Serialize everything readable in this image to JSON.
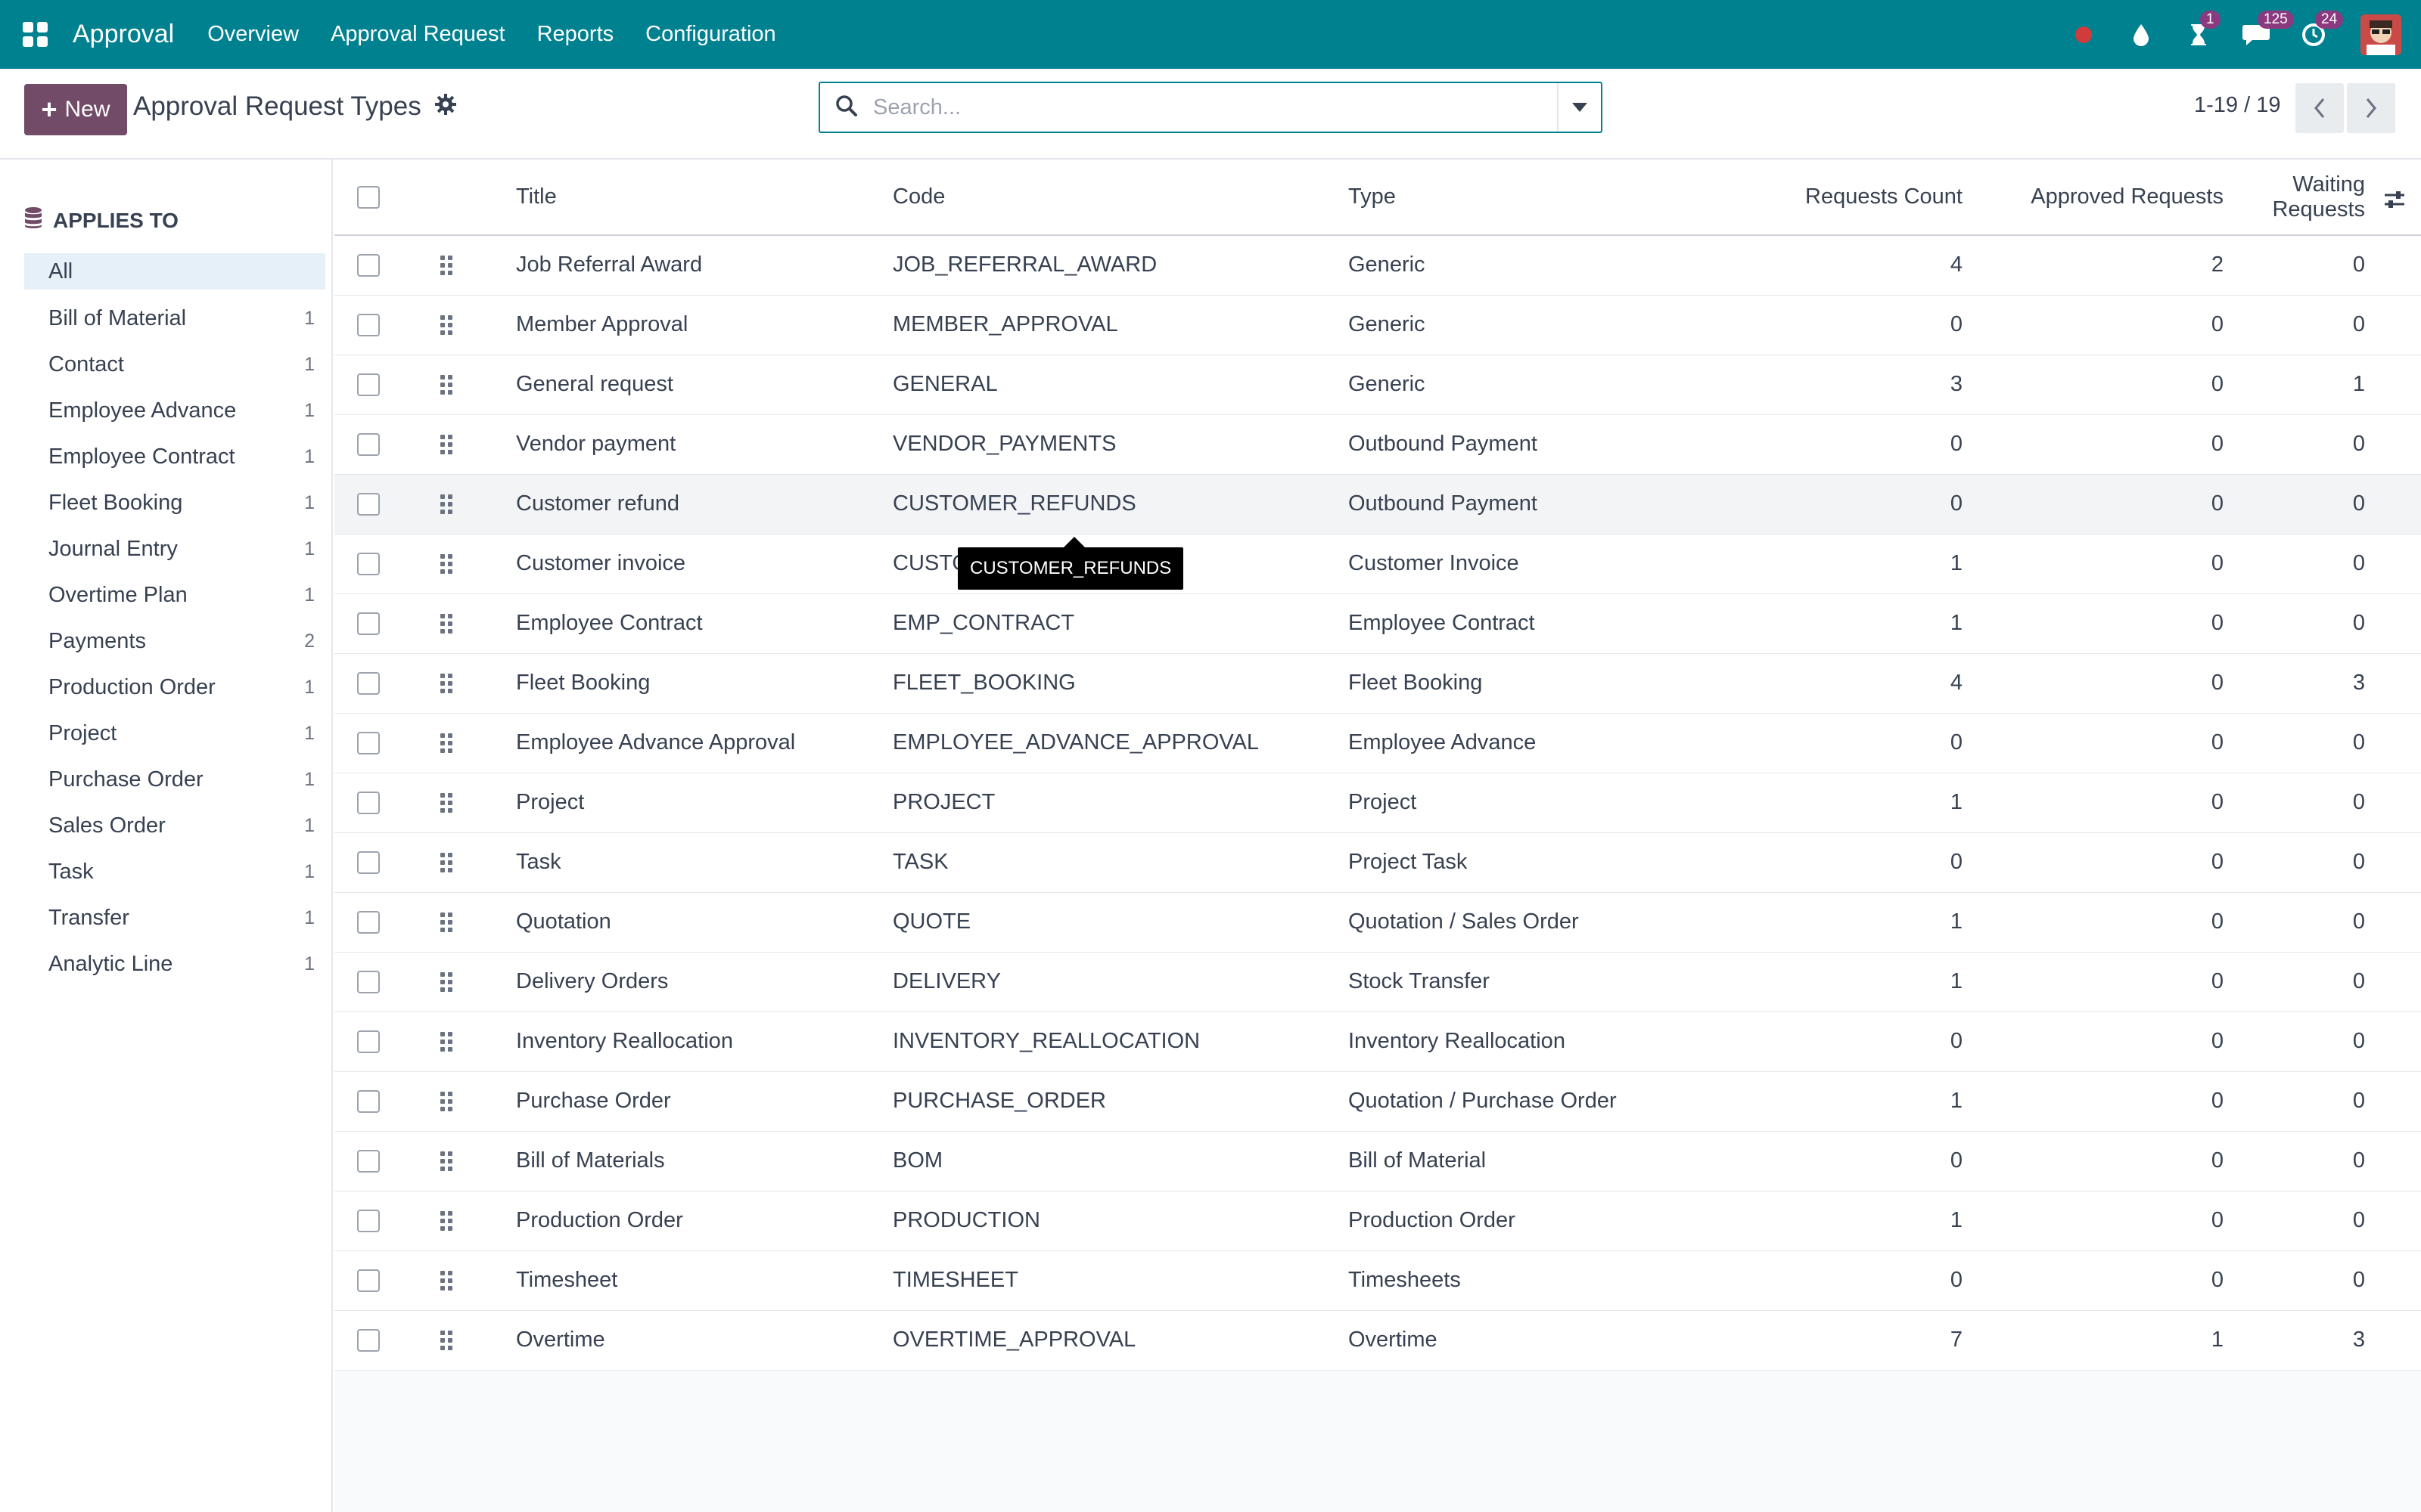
{
  "navbar": {
    "app_name": "Approval",
    "menu": [
      "Overview",
      "Approval Request",
      "Reports",
      "Configuration"
    ],
    "activity_badge": "1",
    "messages_badge": "125",
    "timer_badge": "24"
  },
  "control": {
    "new_label": "New",
    "page_title": "Approval Request Types",
    "search_placeholder": "Search...",
    "pager": "1-19 / 19"
  },
  "sidebar": {
    "heading": "APPLIES TO",
    "items": [
      {
        "label": "All",
        "count": ""
      },
      {
        "label": "Bill of Material",
        "count": "1"
      },
      {
        "label": "Contact",
        "count": "1"
      },
      {
        "label": "Employee Advance",
        "count": "1"
      },
      {
        "label": "Employee Contract",
        "count": "1"
      },
      {
        "label": "Fleet Booking",
        "count": "1"
      },
      {
        "label": "Journal Entry",
        "count": "1"
      },
      {
        "label": "Overtime Plan",
        "count": "1"
      },
      {
        "label": "Payments",
        "count": "2"
      },
      {
        "label": "Production Order",
        "count": "1"
      },
      {
        "label": "Project",
        "count": "1"
      },
      {
        "label": "Purchase Order",
        "count": "1"
      },
      {
        "label": "Sales Order",
        "count": "1"
      },
      {
        "label": "Task",
        "count": "1"
      },
      {
        "label": "Transfer",
        "count": "1"
      },
      {
        "label": "Analytic Line",
        "count": "1"
      }
    ]
  },
  "table": {
    "headers": {
      "title": "Title",
      "code": "Code",
      "type": "Type",
      "requests": "Requests Count",
      "approved": "Approved Requests",
      "waiting": "Waiting Requests"
    },
    "rows": [
      {
        "title": "Job Referral Award",
        "code": "JOB_REFERRAL_AWARD",
        "type": "Generic",
        "requests": "4",
        "approved": "2",
        "waiting": "0"
      },
      {
        "title": "Member Approval",
        "code": "MEMBER_APPROVAL",
        "type": "Generic",
        "requests": "0",
        "approved": "0",
        "waiting": "0"
      },
      {
        "title": "General request",
        "code": "GENERAL",
        "type": "Generic",
        "requests": "3",
        "approved": "0",
        "waiting": "1"
      },
      {
        "title": "Vendor payment",
        "code": "VENDOR_PAYMENTS",
        "type": "Outbound Payment",
        "requests": "0",
        "approved": "0",
        "waiting": "0"
      },
      {
        "title": "Customer refund",
        "code": "CUSTOMER_REFUNDS",
        "type": "Outbound Payment",
        "requests": "0",
        "approved": "0",
        "waiting": "0"
      },
      {
        "title": "Customer invoice",
        "code": "CUSTOMEI",
        "type": "Customer Invoice",
        "requests": "1",
        "approved": "0",
        "waiting": "0"
      },
      {
        "title": "Employee Contract",
        "code": "EMP_CONTRACT",
        "type": "Employee Contract",
        "requests": "1",
        "approved": "0",
        "waiting": "0"
      },
      {
        "title": "Fleet Booking",
        "code": "FLEET_BOOKING",
        "type": "Fleet Booking",
        "requests": "4",
        "approved": "0",
        "waiting": "3"
      },
      {
        "title": "Employee Advance Approval",
        "code": "EMPLOYEE_ADVANCE_APPROVAL",
        "type": "Employee Advance",
        "requests": "0",
        "approved": "0",
        "waiting": "0"
      },
      {
        "title": "Project",
        "code": "PROJECT",
        "type": "Project",
        "requests": "1",
        "approved": "0",
        "waiting": "0"
      },
      {
        "title": "Task",
        "code": "TASK",
        "type": "Project Task",
        "requests": "0",
        "approved": "0",
        "waiting": "0"
      },
      {
        "title": "Quotation",
        "code": "QUOTE",
        "type": "Quotation / Sales Order",
        "requests": "1",
        "approved": "0",
        "waiting": "0"
      },
      {
        "title": "Delivery Orders",
        "code": "DELIVERY",
        "type": "Stock Transfer",
        "requests": "1",
        "approved": "0",
        "waiting": "0"
      },
      {
        "title": "Inventory Reallocation",
        "code": "INVENTORY_REALLOCATION",
        "type": "Inventory Reallocation",
        "requests": "0",
        "approved": "0",
        "waiting": "0"
      },
      {
        "title": "Purchase Order",
        "code": "PURCHASE_ORDER",
        "type": "Quotation / Purchase Order",
        "requests": "1",
        "approved": "0",
        "waiting": "0"
      },
      {
        "title": "Bill of Materials",
        "code": "BOM",
        "type": "Bill of Material",
        "requests": "0",
        "approved": "0",
        "waiting": "0"
      },
      {
        "title": "Production Order",
        "code": "PRODUCTION",
        "type": "Production Order",
        "requests": "1",
        "approved": "0",
        "waiting": "0"
      },
      {
        "title": "Timesheet",
        "code": "TIMESHEET",
        "type": "Timesheets",
        "requests": "0",
        "approved": "0",
        "waiting": "0"
      },
      {
        "title": "Overtime",
        "code": "OVERTIME_APPROVAL",
        "type": "Overtime",
        "requests": "7",
        "approved": "1",
        "waiting": "3"
      }
    ]
  },
  "tooltip": {
    "text": "CUSTOMER_REFUNDS"
  },
  "colors": {
    "navbar": "#00818f",
    "primary": "#714b67",
    "badge": "#8b3a7f",
    "record": "#d03b3b"
  }
}
